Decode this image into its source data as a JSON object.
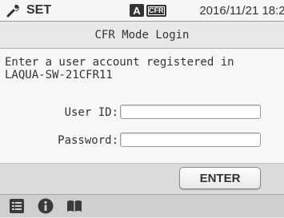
{
  "statusbar": {
    "mode_icon": "wrench-icon",
    "mode_label": "SET",
    "badge_a": "A",
    "badge_cfr": "CFR",
    "datetime": "2016/11/21 18:24"
  },
  "title": "CFR Mode Login",
  "message": {
    "line1": "Enter a user account registered in",
    "line2": "LAQUA-SW-21CFR11"
  },
  "form": {
    "user_id_label": "User ID:",
    "user_id_value": "",
    "password_label": "Password:",
    "password_value": ""
  },
  "actions": {
    "enter_label": "ENTER"
  },
  "bottombar": {
    "icons": [
      "list-icon",
      "info-icon",
      "book-icon"
    ]
  },
  "colors": {
    "text": "#333333",
    "badge_bg": "#333333",
    "screen_bg": "#f7f7f7",
    "bar_bg": "#dcdcdc"
  }
}
